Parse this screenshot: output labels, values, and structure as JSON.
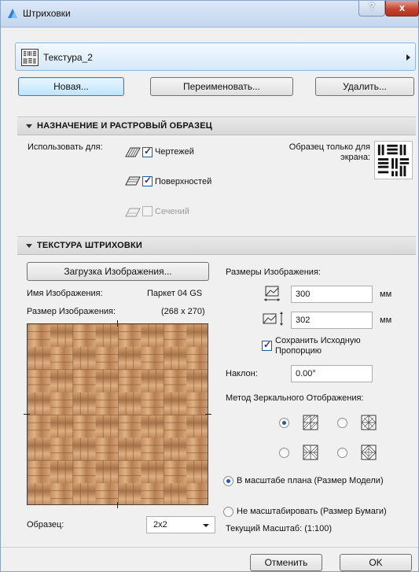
{
  "window": {
    "title": "Штриховки",
    "help_label": "?",
    "close_label": "x"
  },
  "selector": {
    "current": "Текстура_2"
  },
  "buttons": {
    "new": "Новая...",
    "rename": "Переименовать...",
    "delete": "Удалить..."
  },
  "assignment": {
    "header": "НАЗНАЧЕНИЕ И РАСТРОВЫЙ ОБРАЗЕЦ",
    "use_for_label": "Использовать для:",
    "options": [
      {
        "label": "Чертежей",
        "checked": true,
        "enabled": true
      },
      {
        "label": "Поверхностей",
        "checked": true,
        "enabled": true
      },
      {
        "label": "Сечений",
        "checked": false,
        "enabled": false
      }
    ],
    "screen_only_label": "Образец только для экрана:"
  },
  "texture": {
    "header": "ТЕКСТУРА ШТРИХОВКИ",
    "load_button": "Загрузка Изображения...",
    "image_name_label": "Имя Изображения:",
    "image_name_value": "Паркет 04 GS",
    "image_size_label": "Размер Изображения:",
    "image_size_value": "(268 x 270)",
    "sample_label": "Образец:",
    "sample_value": "2x2",
    "dimensions_label": "Размеры Изображения:",
    "width_value": "300",
    "height_value": "302",
    "unit": "мм",
    "keep_ratio_label": "Сохранить Исходную Пропорцию",
    "keep_ratio_checked": true,
    "angle_label": "Наклон:",
    "angle_value": "0.00°",
    "mirror_label": "Метод Зеркального Отображения:",
    "mirror_selected": 0,
    "scale_model_label": "В масштабе плана (Размер Модели)",
    "scale_paper_label": "Не масштабировать (Размер Бумаги)",
    "scale_selected": "model",
    "current_scale": "Текущий Масштаб: (1:100)"
  },
  "footer": {
    "cancel": "Отменить",
    "ok": "OK"
  },
  "colors": {
    "accent": "#1e5bab",
    "wood_light": "#d7a679",
    "wood_dark": "#a9754b"
  }
}
